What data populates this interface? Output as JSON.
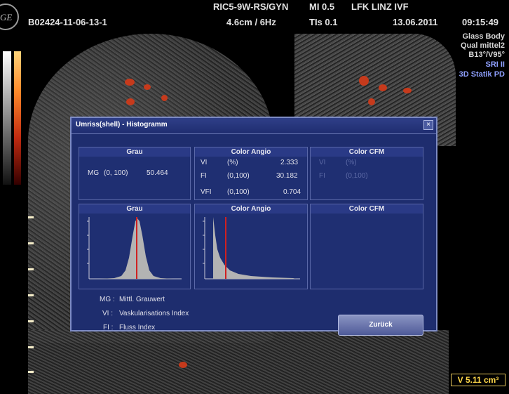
{
  "header": {
    "probe": "RIC5-9W-RS/GYN",
    "mi": "MI  0.5",
    "site": "LFK LINZ IVF",
    "patient_id": "B02424-11-06-13-1",
    "depth_freq": "4.6cm / 6Hz",
    "tis": "TIs  0.1",
    "date": "13.06.2011",
    "time": "09:15:49",
    "logo": "GE"
  },
  "info": {
    "line1": "Glass Body",
    "line2": "Qual mittel2",
    "line3": "B13°/V95°",
    "line4": "SRI II",
    "line5": "3D Statik PD"
  },
  "dialog": {
    "title": "Umriss(shell) - Histogramm",
    "close_icon": "close-icon",
    "panels": {
      "grau_top": {
        "header": "Grau",
        "label": "MG",
        "range": "(0, 100)",
        "value": "50.464"
      },
      "color_angio_top": {
        "header": "Color Angio",
        "rows": [
          {
            "label": "VI",
            "range": "(%)",
            "value": "2.333"
          },
          {
            "label": "FI",
            "range": "(0,100)",
            "value": "30.182"
          },
          {
            "label": "VFI",
            "range": "(0,100)",
            "value": "0.704"
          }
        ]
      },
      "color_cfm_top": {
        "header": "Color CFM",
        "rows": [
          {
            "label": "VI",
            "range": "(%)"
          },
          {
            "label": "FI",
            "range": "(0,100)"
          }
        ]
      },
      "grau_hist": {
        "header": "Grau"
      },
      "color_angio_hist": {
        "header": "Color Angio"
      },
      "color_cfm_hist": {
        "header": "Color CFM"
      }
    },
    "legend": [
      {
        "key": "MG :",
        "text": "Mittl. Grauwert"
      },
      {
        "key": "VI :",
        "text": "Vaskularisations Index"
      },
      {
        "key": "FI :",
        "text": "Fluss Index"
      }
    ],
    "back_button": "Zurück"
  },
  "volume": "V 5.11 cm³",
  "colors": {
    "dialog_bg": "#1e2d6e",
    "panel_bg": "#1f2f72",
    "accent_line": "#d02020",
    "volume_text": "#ffd84a"
  }
}
